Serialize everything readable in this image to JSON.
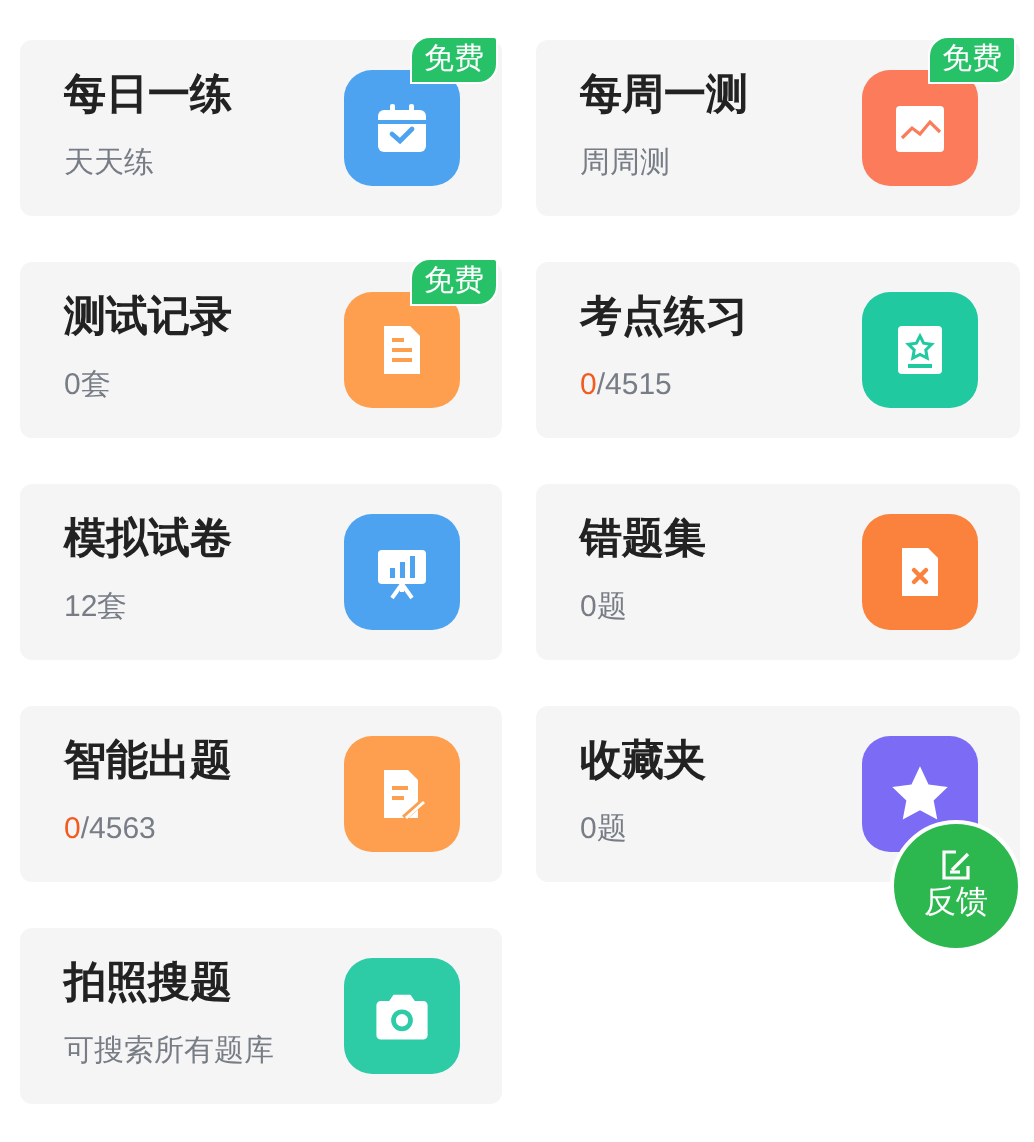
{
  "cards": [
    {
      "title": "每日一练",
      "subtitle": {
        "kind": "text",
        "text": "天天练"
      },
      "color": "#4da3f0",
      "badge": "免费"
    },
    {
      "title": "每周一测",
      "subtitle": {
        "kind": "text",
        "text": "周周测"
      },
      "color": "#fb7b5b",
      "badge": "免费"
    },
    {
      "title": "测试记录",
      "subtitle": {
        "kind": "text",
        "text": "0套"
      },
      "color": "#fd9f4f",
      "badge": "免费"
    },
    {
      "title": "考点练习",
      "subtitle": {
        "kind": "progress",
        "done": "0",
        "rest": "/4515"
      },
      "color": "#20c9a0"
    },
    {
      "title": "模拟试卷",
      "subtitle": {
        "kind": "text",
        "text": "12套"
      },
      "color": "#4da3f0"
    },
    {
      "title": "错题集",
      "subtitle": {
        "kind": "text",
        "text": "0题"
      },
      "color": "#fb823c"
    },
    {
      "title": "智能出题",
      "subtitle": {
        "kind": "progress",
        "done": "0",
        "rest": "/4563"
      },
      "color": "#fd9f4f"
    },
    {
      "title": "收藏夹",
      "subtitle": {
        "kind": "text",
        "text": "0题"
      },
      "color": "#7c6cf5"
    },
    {
      "title": "拍照搜题",
      "subtitle": {
        "kind": "text",
        "text": "可搜索所有题库"
      },
      "color": "#2dcca6"
    }
  ],
  "feedback": {
    "label": "反馈"
  }
}
